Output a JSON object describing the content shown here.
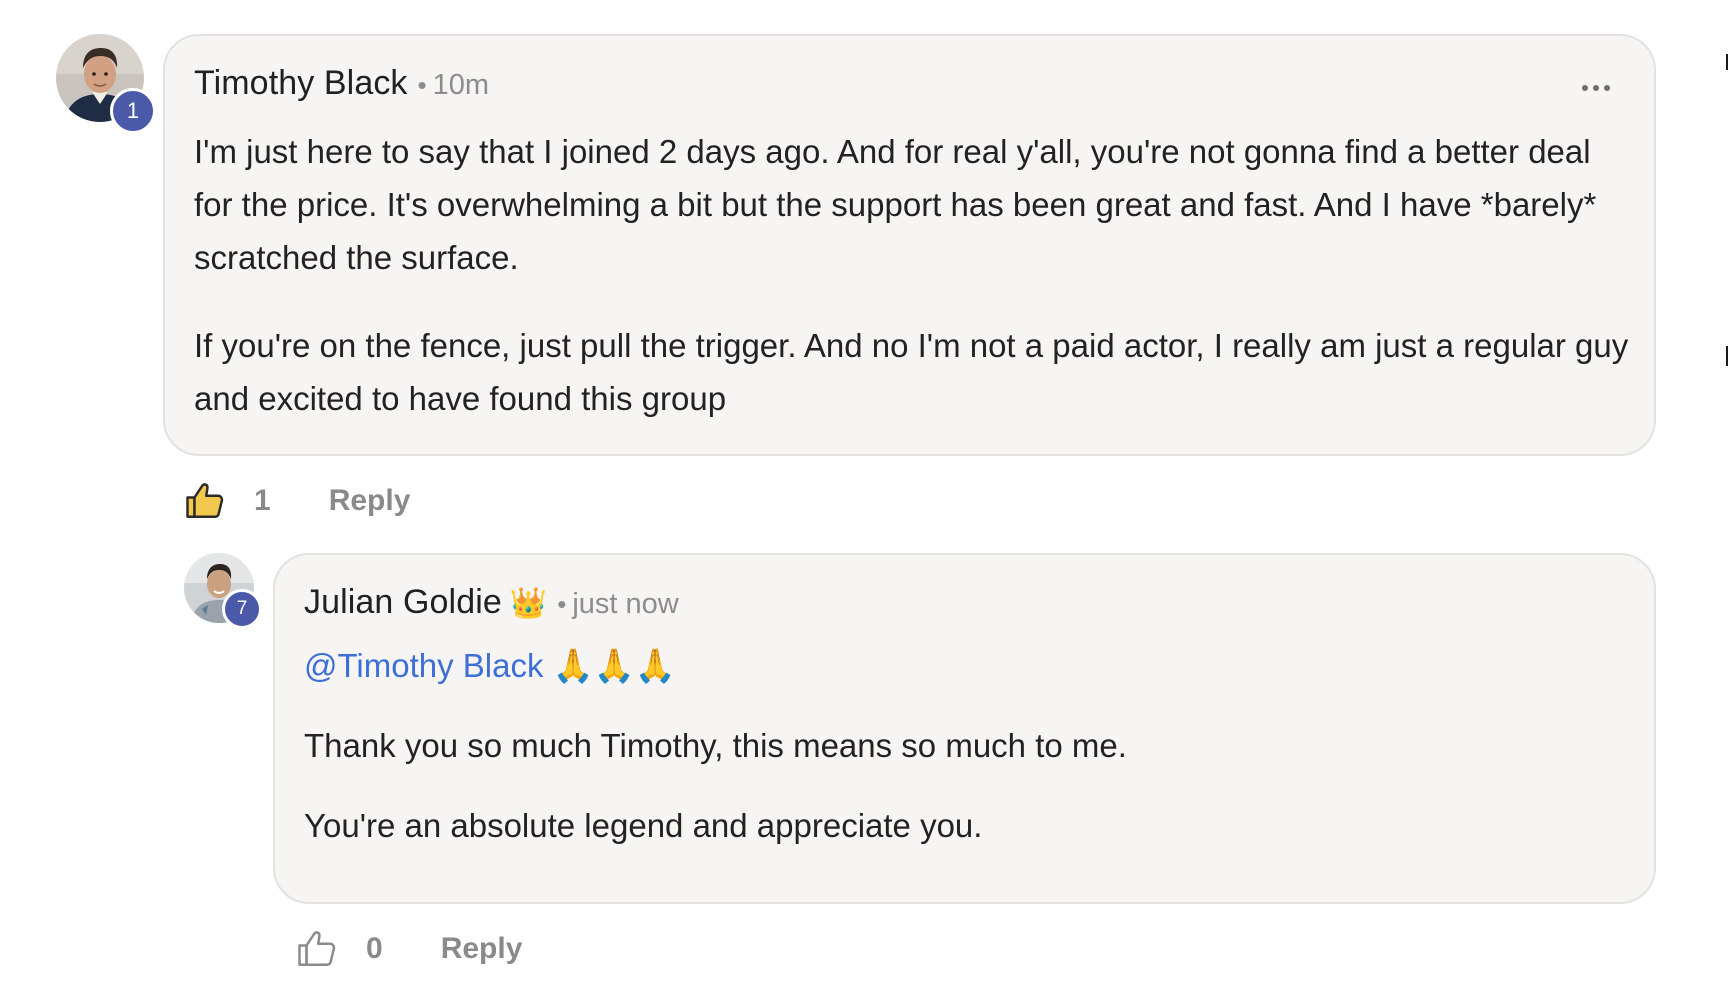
{
  "comment": {
    "author": "Timothy Black",
    "author_level": "1",
    "time": "10m",
    "paragraphs": [
      "I'm just here to say that I joined 2 days ago. And for real y'all, you're not gonna find a better deal for the price. It's overwhelming a bit but the support has been great and fast. And I have *barely* scratched the surface.",
      "If you're on the fence, just pull the trigger. And no I'm not a paid actor, I really am just a regular guy and excited to have found this group"
    ],
    "like_count": "1",
    "liked": true,
    "reply_label": "Reply",
    "more_icon": "more-horizontal-icon"
  },
  "reply": {
    "author": "Julian Goldie",
    "author_badge": "👑",
    "author_level": "7",
    "time": "just now",
    "mention": "@Timothy Black",
    "mention_emoji": "🙏🙏🙏",
    "paragraphs": [
      "Thank you so much Timothy, this means so much to me.",
      "You're an absolute legend and appreciate you."
    ],
    "like_count": "0",
    "liked": false,
    "reply_label": "Reply"
  },
  "colors": {
    "bubble_bg": "#f6f5f4",
    "bubble_border": "#e3e2e0",
    "level_badge": "#4a5aa8",
    "mention": "#3d6fd6",
    "like_active": "#f2c94c",
    "muted": "#8a8a8a"
  },
  "icons": {
    "like": "thumbs-up-icon",
    "more": "more-horizontal-icon",
    "crown": "crown-icon"
  }
}
